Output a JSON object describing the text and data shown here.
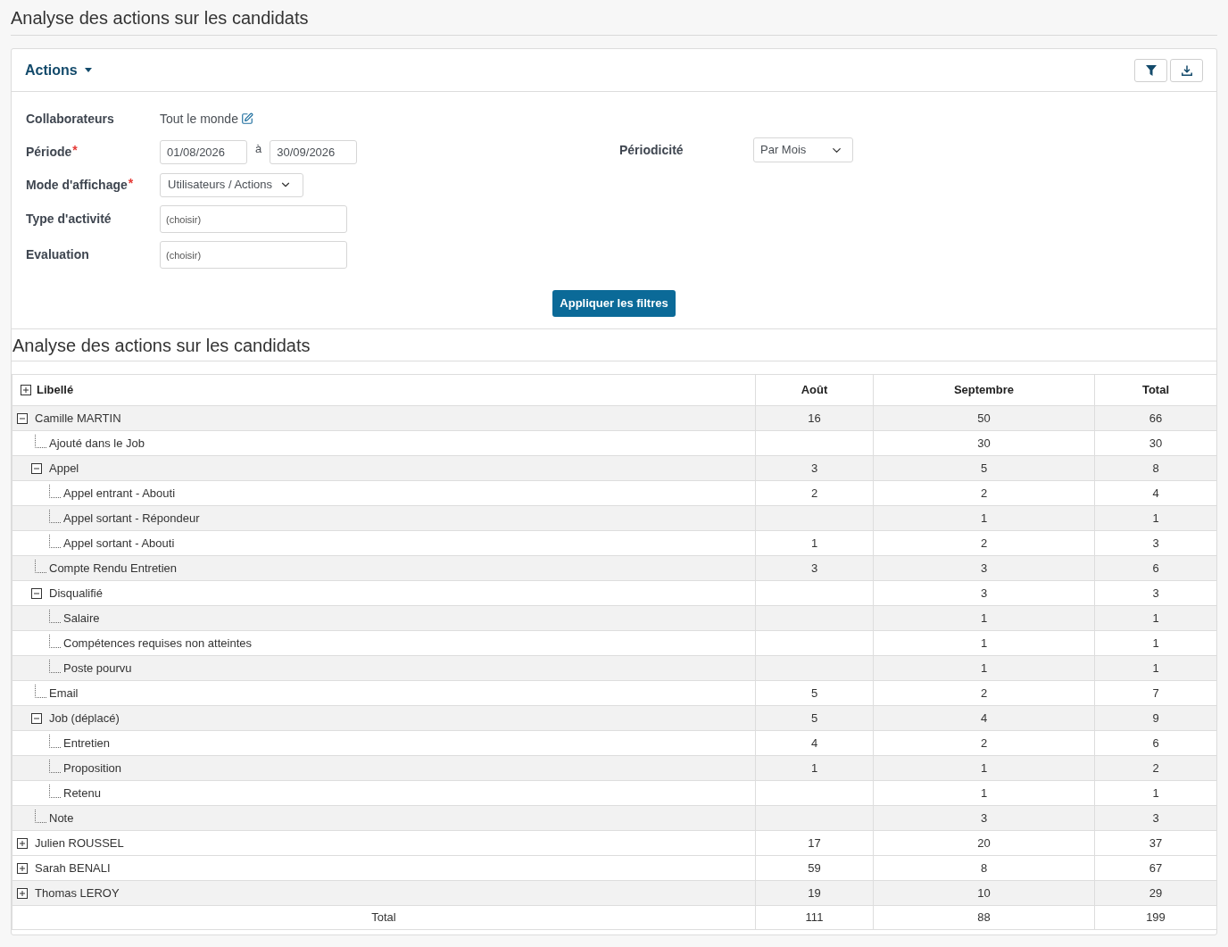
{
  "page_title": "Analyse des actions sur les candidats",
  "panel": {
    "title": "Actions",
    "tools": [
      {
        "kind": "filter"
      },
      {
        "kind": "download"
      }
    ]
  },
  "filters": [
    {
      "kind": "people",
      "label": "Collaborateurs",
      "value": "Tout le monde"
    },
    {
      "kind": "date_range",
      "label": "Période",
      "required_mark": "*",
      "from": "01/08/2026",
      "separator": "à",
      "to": "30/09/2026"
    },
    {
      "kind": "select",
      "label": "Mode d'affichage",
      "required_mark": "*",
      "value": "Utilisateurs / Actions"
    },
    {
      "kind": "multiselect",
      "label": "Type d'activité",
      "placeholder": "(choisir)"
    },
    {
      "kind": "multiselect",
      "label": "Evaluation",
      "placeholder": "(choisir)"
    }
  ],
  "side_filter": {
    "label": "Périodicité",
    "value": "Par Mois"
  },
  "apply_button": "Appliquer les filtres",
  "report": {
    "title": "Analyse des actions sur les candidats",
    "columns": [
      "Libellé",
      "Août",
      "Septembre",
      "Total"
    ],
    "rows": [
      {
        "label": "Camille MARTIN",
        "values": {
          "aout": "16",
          "septembre": "50",
          "total": "66"
        },
        "shaded": true,
        "expanded": true,
        "children": [
          {
            "label": "Ajouté dans le Job",
            "values": {
              "septembre": "30",
              "total": "30"
            },
            "shaded": false
          },
          {
            "label": "Appel",
            "values": {
              "aout": "3",
              "septembre": "5",
              "total": "8"
            },
            "shaded": true,
            "expanded": true,
            "children": [
              {
                "label": "Appel entrant - Abouti",
                "values": {
                  "aout": "2",
                  "septembre": "2",
                  "total": "4"
                },
                "shaded": false
              },
              {
                "label": "Appel sortant - Répondeur",
                "values": {
                  "septembre": "1",
                  "total": "1"
                },
                "shaded": true
              },
              {
                "label": "Appel sortant - Abouti",
                "values": {
                  "aout": "1",
                  "septembre": "2",
                  "total": "3"
                },
                "shaded": false
              }
            ]
          },
          {
            "label": "Compte Rendu Entretien",
            "values": {
              "aout": "3",
              "septembre": "3",
              "total": "6"
            },
            "shaded": true
          },
          {
            "label": "Disqualifié",
            "values": {
              "septembre": "3",
              "total": "3"
            },
            "shaded": false,
            "expanded": true,
            "children": [
              {
                "label": "Salaire",
                "values": {
                  "septembre": "1",
                  "total": "1"
                },
                "shaded": true
              },
              {
                "label": "Compétences requises non atteintes",
                "values": {
                  "septembre": "1",
                  "total": "1"
                },
                "shaded": false
              },
              {
                "label": "Poste pourvu",
                "values": {
                  "septembre": "1",
                  "total": "1"
                },
                "shaded": true
              }
            ]
          },
          {
            "label": "Email",
            "values": {
              "aout": "5",
              "septembre": "2",
              "total": "7"
            },
            "shaded": false
          },
          {
            "label": "Job (déplacé)",
            "values": {
              "aout": "5",
              "septembre": "4",
              "total": "9"
            },
            "shaded": true,
            "expanded": true,
            "children": [
              {
                "label": "Entretien",
                "values": {
                  "aout": "4",
                  "septembre": "2",
                  "total": "6"
                },
                "shaded": false
              },
              {
                "label": "Proposition",
                "values": {
                  "aout": "1",
                  "septembre": "1",
                  "total": "2"
                },
                "shaded": true
              },
              {
                "label": "Retenu",
                "values": {
                  "septembre": "1",
                  "total": "1"
                },
                "shaded": false
              }
            ]
          },
          {
            "label": "Note",
            "values": {
              "septembre": "3",
              "total": "3"
            },
            "shaded": true
          }
        ]
      },
      {
        "label": "Julien ROUSSEL",
        "values": {
          "aout": "17",
          "septembre": "20",
          "total": "37"
        },
        "shaded": false,
        "expanded": false
      },
      {
        "label": "Sarah BENALI",
        "values": {
          "aout": "59",
          "septembre": "8",
          "total": "67"
        },
        "shaded": false,
        "expanded": false
      },
      {
        "label": "Thomas LEROY",
        "values": {
          "aout": "19",
          "septembre": "10",
          "total": "29"
        },
        "shaded": true,
        "expanded": false
      }
    ],
    "total": {
      "label": "Total",
      "values": {
        "aout": "111",
        "septembre": "88",
        "total": "199"
      }
    }
  }
}
